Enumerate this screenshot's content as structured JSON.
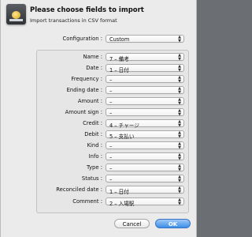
{
  "dialog": {
    "title": "Please choose fields to import",
    "subtitle": "Import transactions in CSV format"
  },
  "configuration": {
    "label": "Configuration :",
    "value": "Custom"
  },
  "fields": [
    {
      "label": "Name :",
      "value": "7 – 備考"
    },
    {
      "label": "Date :",
      "value": "1 – 日付"
    },
    {
      "label": "Frequency :",
      "value": "–"
    },
    {
      "label": "Ending date :",
      "value": "–"
    },
    {
      "label": "Amount :",
      "value": "–"
    },
    {
      "label": "Amount sign :",
      "value": "–"
    },
    {
      "label": "Credit :",
      "value": "4 – チャージ"
    },
    {
      "label": "Debit :",
      "value": "5 – 支払い"
    },
    {
      "label": "Kind :",
      "value": "–"
    },
    {
      "label": "Info :",
      "value": "–"
    },
    {
      "label": "Type :",
      "value": "–"
    },
    {
      "label": "Status :",
      "value": "–"
    },
    {
      "label": "Reconciled date :",
      "value": "1 – 日付"
    },
    {
      "label": "Comment :",
      "value": "2 – 入場駅"
    }
  ],
  "buttons": {
    "cancel": "Cancel",
    "ok": "OK"
  },
  "icons": {
    "app": "wallet-app-icon",
    "select_arrows": "up-down-chevron-icon"
  },
  "colors": {
    "default_button": "#3b8fe7",
    "dialog_bg": "#ebebeb"
  }
}
